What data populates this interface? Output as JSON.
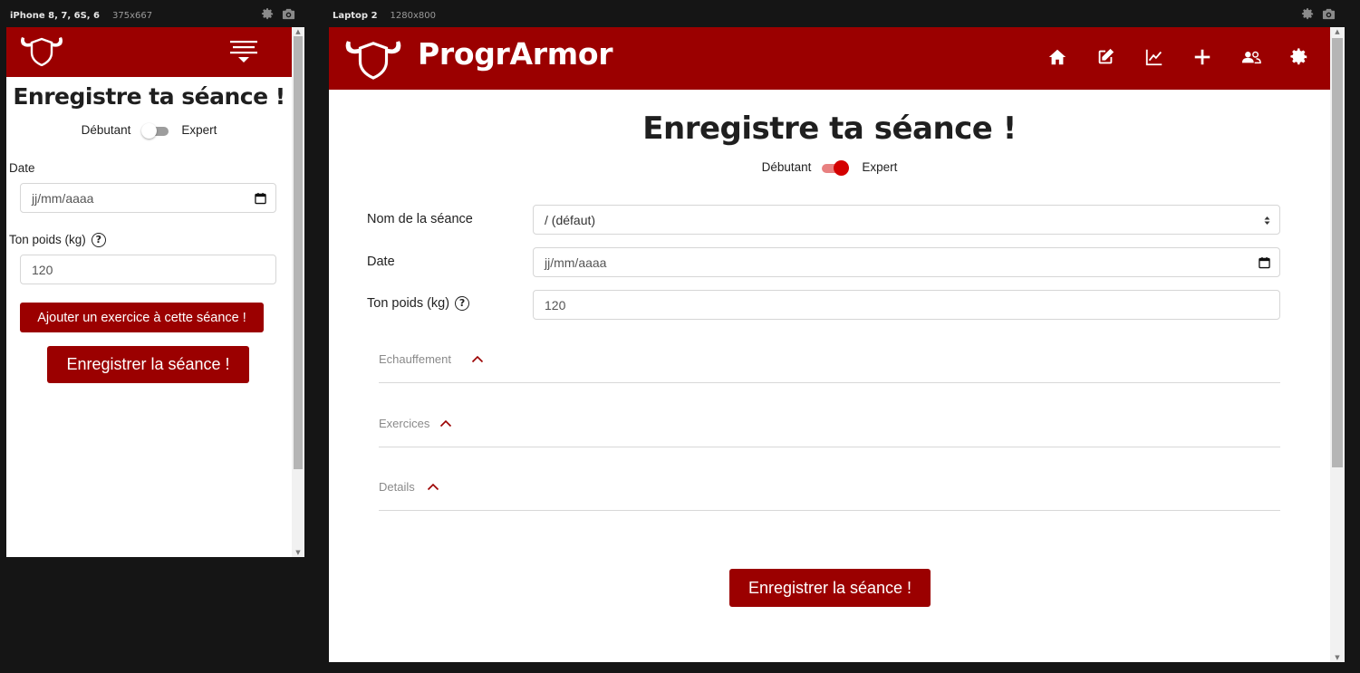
{
  "devices": {
    "phone": {
      "name": "iPhone 8, 7, 6S, 6",
      "size": "375x667"
    },
    "laptop": {
      "name": "Laptop 2",
      "size": "1280x800"
    }
  },
  "brand": {
    "name": "ProgrArmor",
    "color": "#9b0000"
  },
  "page": {
    "title": "Enregistre ta séance !",
    "toggle": {
      "left": "Débutant",
      "right": "Expert"
    }
  },
  "phone": {
    "mode_expert": false,
    "date_label": "Date",
    "date_placeholder": "jj/mm/aaaa",
    "weight_label": "Ton poids (kg)",
    "weight_value": "120",
    "add_exercise_label": "Ajouter un exercice à cette séance !",
    "save_label": "Enregistrer la séance !"
  },
  "laptop": {
    "mode_expert": true,
    "session_name_label": "Nom de la séance",
    "session_name_value": "/ (défaut)",
    "date_label": "Date",
    "date_placeholder": "jj/mm/aaaa",
    "weight_label": "Ton poids (kg)",
    "weight_value": "120",
    "sections": [
      "Echauffement",
      "Exercices",
      "Details"
    ],
    "save_label": "Enregistrer la séance !",
    "nav_icons": [
      "home-icon",
      "edit-icon",
      "chart-icon",
      "plus-icon",
      "users-icon",
      "settings-icon"
    ]
  }
}
